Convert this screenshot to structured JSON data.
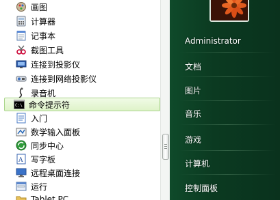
{
  "programs": [
    {
      "label": "画图",
      "icon": "paint-icon"
    },
    {
      "label": "计算器",
      "icon": "calculator-icon"
    },
    {
      "label": "记事本",
      "icon": "notepad-icon"
    },
    {
      "label": "截图工具",
      "icon": "snipping-tool-icon"
    },
    {
      "label": "连接到投影仪",
      "icon": "projector-icon"
    },
    {
      "label": "连接到网络投影仪",
      "icon": "network-projector-icon"
    },
    {
      "label": "录音机",
      "icon": "microphone-icon"
    },
    {
      "label": "命令提示符",
      "icon": "cmd-icon"
    },
    {
      "label": "入门",
      "icon": "getting-started-icon"
    },
    {
      "label": "数学输入面板",
      "icon": "math-input-icon"
    },
    {
      "label": "同步中心",
      "icon": "sync-center-icon"
    },
    {
      "label": "写字板",
      "icon": "wordpad-icon"
    },
    {
      "label": "远程桌面连接",
      "icon": "remote-desktop-icon"
    },
    {
      "label": "运行",
      "icon": "run-icon"
    },
    {
      "label": "Tablet PC",
      "icon": "folder-icon"
    }
  ],
  "selected_index": 7,
  "right_menu": [
    {
      "label": "Administrator"
    },
    {
      "label": "文档"
    },
    {
      "label": "图片"
    },
    {
      "label": "音乐"
    },
    {
      "label": "游戏"
    },
    {
      "label": "计算机"
    },
    {
      "label": "控制面板"
    }
  ],
  "colors": {
    "right_pane_bg": "#0c3b24",
    "selection_border": "#a8d48a"
  }
}
